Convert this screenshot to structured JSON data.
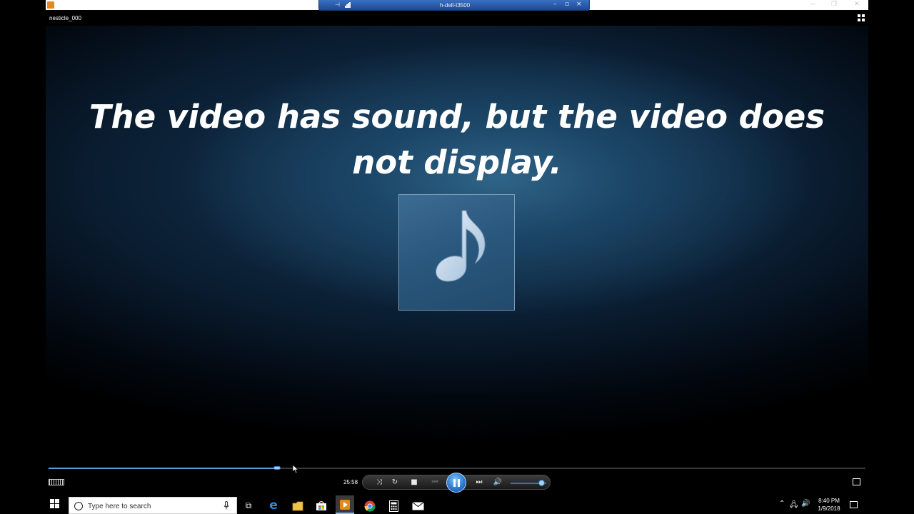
{
  "remote_session": {
    "host": "h-dell-t3500"
  },
  "player": {
    "video_title": "nesticle_000",
    "overlay_line1": "The video has sound, but the video does",
    "overlay_line2": "not display.",
    "elapsed_time": "25:58",
    "seek_progress_pct": 28,
    "volume_pct": 85
  },
  "taskbar": {
    "search_placeholder": "Type here to search",
    "clock_time": "8:40 PM",
    "clock_date": "1/9/2018"
  },
  "colors": {
    "accent_blue": "#2e7ad0",
    "connection_bar": "#1e4a96"
  }
}
